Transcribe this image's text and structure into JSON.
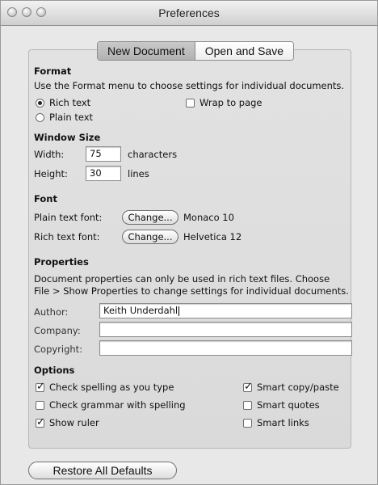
{
  "window": {
    "title": "Preferences"
  },
  "tabs": [
    {
      "label": "New Document",
      "active": true
    },
    {
      "label": "Open and Save",
      "active": false
    }
  ],
  "format": {
    "title": "Format",
    "description": "Use the Format menu to choose settings for individual documents.",
    "rich_text_label": "Rich text",
    "plain_text_label": "Plain text",
    "selected": "Rich text",
    "wrap_label": "Wrap to page",
    "wrap_checked": false
  },
  "window_size": {
    "title": "Window Size",
    "width_label": "Width:",
    "width_value": "75",
    "width_unit": "characters",
    "height_label": "Height:",
    "height_value": "30",
    "height_unit": "lines"
  },
  "font": {
    "title": "Font",
    "plain_label": "Plain text font:",
    "plain_button": "Change...",
    "plain_value": "Monaco 10",
    "rich_label": "Rich text font:",
    "rich_button": "Change...",
    "rich_value": "Helvetica 12"
  },
  "properties": {
    "title": "Properties",
    "description_line1": "Document properties can only be used in rich text files. Choose",
    "description_line2": "File > Show Properties to change settings for individual documents.",
    "author_label": "Author:",
    "author_value": "Keith Underdahl",
    "company_label": "Company:",
    "company_value": "",
    "copyright_label": "Copyright:",
    "copyright_value": ""
  },
  "options": {
    "title": "Options",
    "check_spelling": {
      "label": "Check spelling as you type",
      "checked": true
    },
    "check_grammar": {
      "label": "Check grammar with spelling",
      "checked": false
    },
    "show_ruler": {
      "label": "Show ruler",
      "checked": true
    },
    "smart_copy": {
      "label": "Smart copy/paste",
      "checked": true
    },
    "smart_quotes": {
      "label": "Smart quotes",
      "checked": false
    },
    "smart_links": {
      "label": "Smart links",
      "checked": false
    }
  },
  "footer": {
    "restore_label": "Restore All Defaults"
  }
}
